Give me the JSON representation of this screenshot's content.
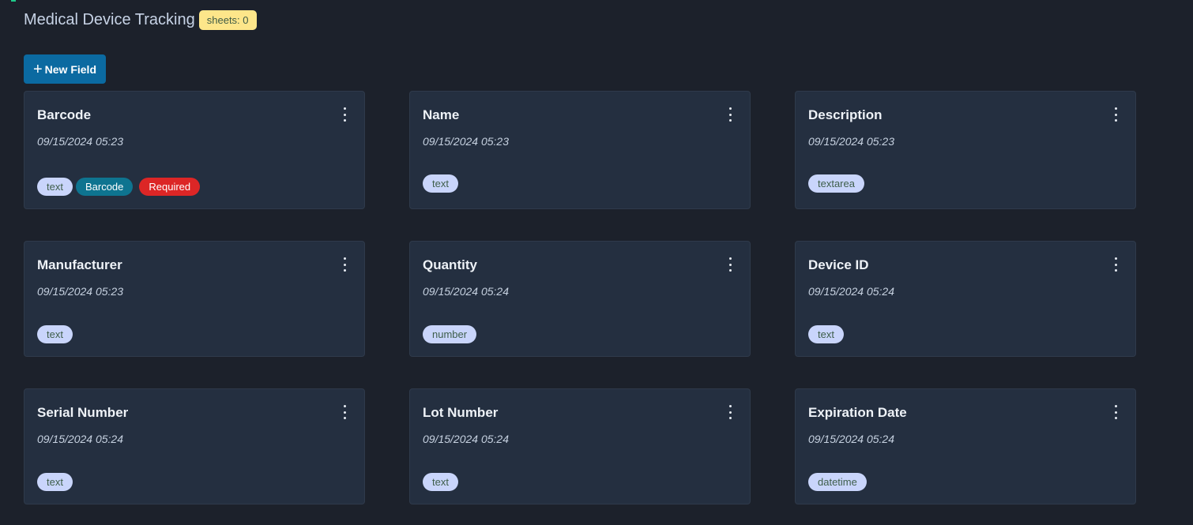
{
  "header": {
    "title": "Medical Device Tracking",
    "sheets_badge": "sheets: 0"
  },
  "toolbar": {
    "new_field_icon": "plus-icon",
    "new_field_label": "New Field"
  },
  "fields": [
    {
      "name": "Barcode",
      "date": "09/15/2024 05:23",
      "type": "text",
      "barcode_tag": "Barcode",
      "required_tag": "Required"
    },
    {
      "name": "Name",
      "date": "09/15/2024 05:23",
      "type": "text"
    },
    {
      "name": "Description",
      "date": "09/15/2024 05:23",
      "type": "textarea"
    },
    {
      "name": "Manufacturer",
      "date": "09/15/2024 05:23",
      "type": "text"
    },
    {
      "name": "Quantity",
      "date": "09/15/2024 05:24",
      "type": "number"
    },
    {
      "name": "Device ID",
      "date": "09/15/2024 05:24",
      "type": "text"
    },
    {
      "name": "Serial Number",
      "date": "09/15/2024 05:24",
      "type": "text"
    },
    {
      "name": "Lot Number",
      "date": "09/15/2024 05:24",
      "type": "text"
    },
    {
      "name": "Expiration Date",
      "date": "09/15/2024 05:24",
      "type": "datetime"
    }
  ],
  "colors": {
    "background": "#1c212b",
    "card": "#242f40",
    "primary_button": "#0b6aa1",
    "badge": "#fde68a",
    "type_tag": "#c9d5fb",
    "barcode_tag": "#0e7490",
    "required_tag": "#dc2626"
  }
}
